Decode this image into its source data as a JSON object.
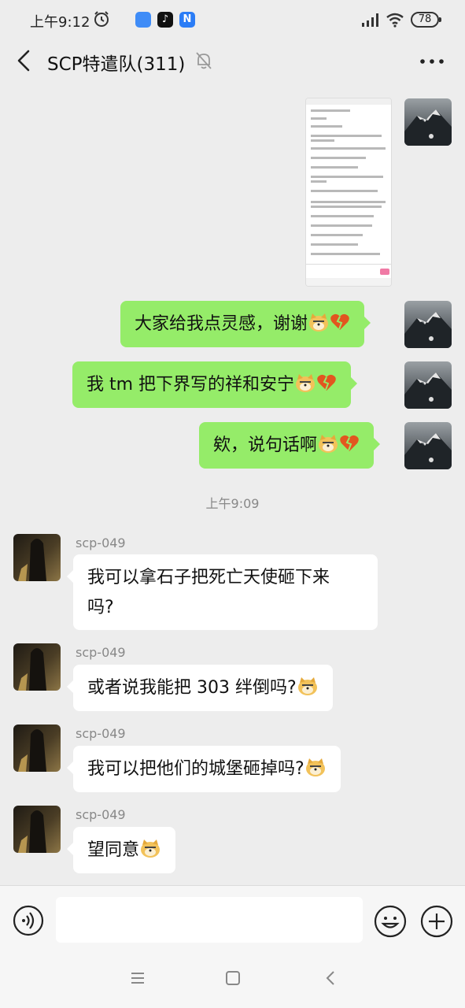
{
  "status": {
    "time": "上午9:12",
    "battery": "78",
    "app_icons": [
      {
        "name": "cloud-app-icon",
        "glyph": "",
        "color": "#3f8cf7"
      },
      {
        "name": "tiktok-icon",
        "glyph": "♪",
        "color": "#111111"
      },
      {
        "name": "news-app-icon",
        "glyph": "N",
        "color": "#2b7df6"
      }
    ]
  },
  "header": {
    "title": "SCP特遣队(311)"
  },
  "messages": {
    "m1": "大家给我点灵感，谢谢",
    "m2": "我 tm 把下界写的祥和安宁",
    "m3": "欸，说句话啊",
    "timestamp": "上午9:09",
    "sender": "scp-049",
    "m4_l1": "我可以拿石子把死亡天使砸下来",
    "m4_l2": "吗?",
    "m5": "或者说我能把 303 绊倒吗?",
    "m6": "我可以把他们的城堡砸掉吗?",
    "m7": "望同意"
  },
  "colors": {
    "outgoing_bubble": "#95ec69",
    "incoming_bubble": "#ffffff",
    "background": "#ededed"
  },
  "icons": [
    "back-icon",
    "mute-icon",
    "more-icon",
    "voice-icon",
    "emoji-icon",
    "plus-icon",
    "doge-emoji",
    "broken-heart-emoji"
  ]
}
